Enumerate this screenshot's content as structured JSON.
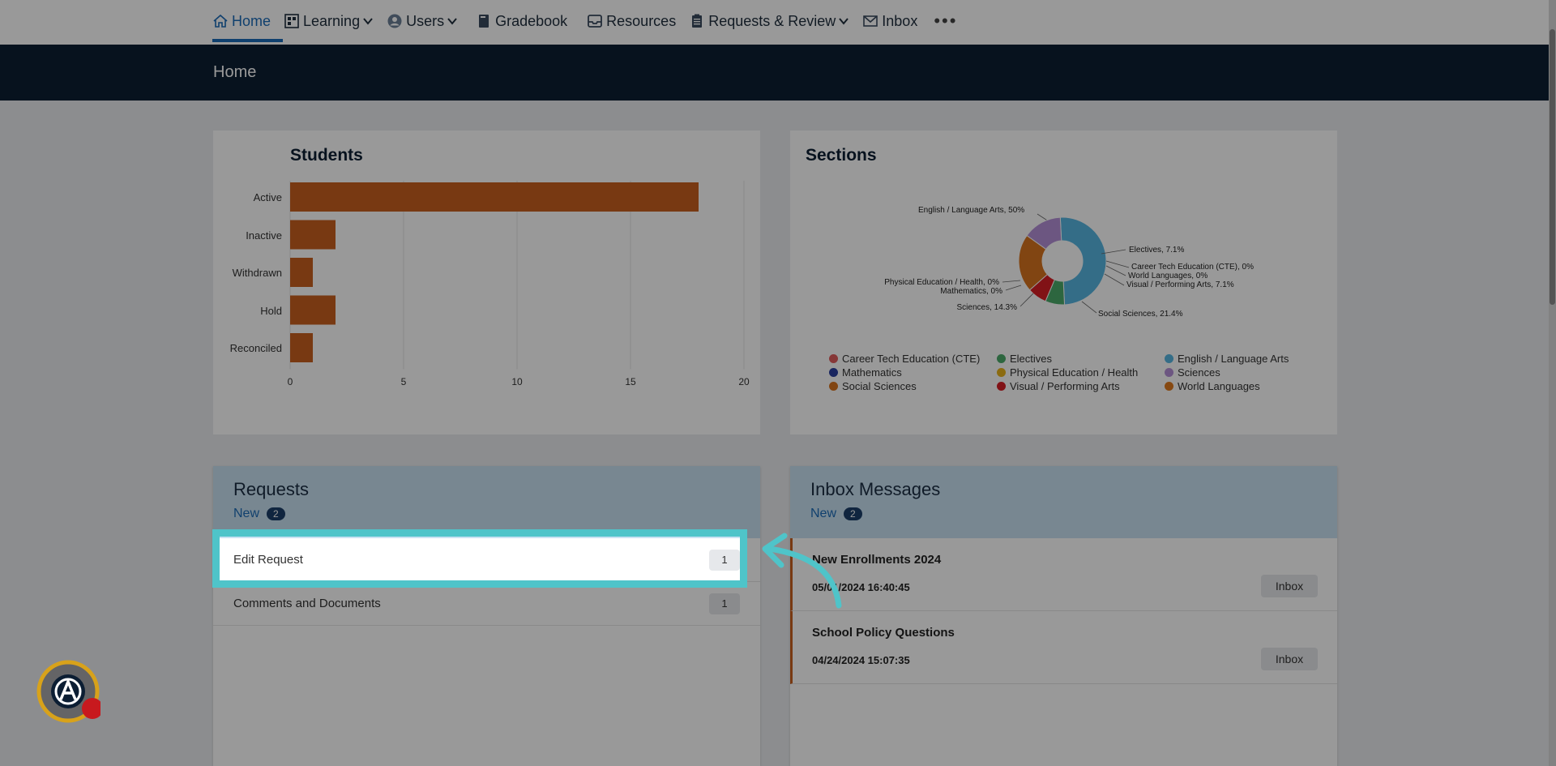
{
  "nav": {
    "items": [
      {
        "label": "Home",
        "icon": "home-icon",
        "active": true
      },
      {
        "label": "Learning",
        "icon": "grid-icon",
        "dropdown": true
      },
      {
        "label": "Users",
        "icon": "user-circle-icon",
        "dropdown": true
      },
      {
        "label": "Gradebook",
        "icon": "book-icon"
      },
      {
        "label": "Resources",
        "icon": "inbox-tray-icon"
      },
      {
        "label": "Requests & Review",
        "icon": "clipboard-icon",
        "dropdown": true
      },
      {
        "label": "Inbox",
        "icon": "mail-icon"
      }
    ],
    "more": "•••"
  },
  "header": {
    "title": "Home"
  },
  "students": {
    "title": "Students",
    "chart_data": {
      "type": "bar",
      "orientation": "horizontal",
      "categories": [
        "Active",
        "Inactive",
        "Withdrawn",
        "Hold",
        "Reconciled"
      ],
      "values": [
        18,
        2,
        1,
        2,
        1
      ],
      "xlim": [
        0,
        20
      ],
      "xticks": [
        "0",
        "5",
        "10",
        "15",
        "20"
      ],
      "bar_color": "#c9601f"
    }
  },
  "sections": {
    "title": "Sections",
    "chart_data": {
      "type": "pie",
      "style": "donut",
      "slices": [
        {
          "label": "English / Language Arts",
          "value": 50,
          "callout": "English / Language Arts, 50%",
          "color": "#57b6e2"
        },
        {
          "label": "Electives",
          "value": 7.1,
          "callout": "Electives, 7.1%",
          "color": "#4caa6a"
        },
        {
          "label": "Career Tech Education (CTE)",
          "value": 0,
          "callout": "Career Tech Education (CTE), 0%",
          "color": "#e05c5c"
        },
        {
          "label": "World Languages",
          "value": 0,
          "callout": "World Languages, 0%",
          "color": "#e07a1f"
        },
        {
          "label": "Visual / Performing Arts",
          "value": 7.1,
          "callout": "Visual / Performing Arts, 7.1%",
          "color": "#d81e25"
        },
        {
          "label": "Social Sciences",
          "value": 21.4,
          "callout": "Social Sciences, 21.4%",
          "color": "#d8741f"
        },
        {
          "label": "Sciences",
          "value": 14.3,
          "callout": "Sciences, 14.3%",
          "color": "#b58fd8"
        },
        {
          "label": "Mathematics",
          "value": 0,
          "callout": "Mathematics, 0%",
          "color": "#2b3f9e"
        },
        {
          "label": "Physical Education / Health",
          "value": 0,
          "callout": "Physical Education / Health, 0%",
          "color": "#e8b21c"
        }
      ],
      "legend": [
        {
          "label": "Career Tech Education (CTE)",
          "color": "#e05c5c"
        },
        {
          "label": "Electives",
          "color": "#4caa6a"
        },
        {
          "label": "English / Language Arts",
          "color": "#57b6e2"
        },
        {
          "label": "Mathematics",
          "color": "#2b3f9e"
        },
        {
          "label": "Physical Education / Health",
          "color": "#e8b21c"
        },
        {
          "label": "Sciences",
          "color": "#b58fd8"
        },
        {
          "label": "Social Sciences",
          "color": "#d8741f"
        },
        {
          "label": "Visual / Performing Arts",
          "color": "#d81e25"
        },
        {
          "label": "World Languages",
          "color": "#e07a1f"
        }
      ],
      "legend_position": "bottom"
    }
  },
  "requests": {
    "title": "Requests",
    "new_label": "New",
    "new_count": "2",
    "rows": [
      {
        "label": "Edit Request",
        "count": "1"
      },
      {
        "label": "Comments and Documents",
        "count": "1"
      }
    ]
  },
  "inbox": {
    "title": "Inbox Messages",
    "new_label": "New",
    "new_count": "2",
    "messages": [
      {
        "title": "New Enrollments 2024",
        "date": "05/01/2024 16:40:45",
        "button": "Inbox"
      },
      {
        "title": "School Policy Questions",
        "date": "04/24/2024 15:07:35",
        "button": "Inbox"
      }
    ]
  },
  "theme": {
    "accent": "#1c6bb8",
    "header_bg": "#0c1e33",
    "highlight": "#4fc4c9"
  }
}
